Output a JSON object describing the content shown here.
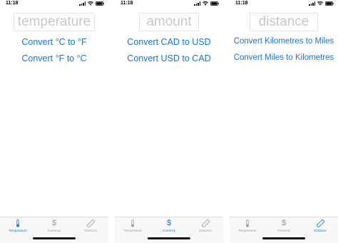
{
  "status_time": "11:18",
  "screens": [
    {
      "input_placeholder": "temperature",
      "buttons": [
        "Convert °C to °F",
        "Convert °F to °C"
      ]
    },
    {
      "input_placeholder": "amount",
      "buttons": [
        "Convert CAD to USD",
        "Convert USD to CAD"
      ]
    },
    {
      "input_placeholder": "distance",
      "buttons": [
        "Convert Kilometres to Miles",
        "Convert Miles to Kilometres"
      ]
    }
  ],
  "tabs": [
    {
      "label": "Temperature",
      "icon": "thermometer-icon"
    },
    {
      "label": "Currency",
      "icon": "dollar-icon"
    },
    {
      "label": "Distance",
      "icon": "ruler-icon"
    }
  ],
  "active_tab_per_screen": [
    "Temperature",
    "Currency",
    "Distance"
  ],
  "colors": {
    "accent": "#1a73d9",
    "inactive": "#9a9a9a",
    "placeholder": "#c7c7cc"
  }
}
